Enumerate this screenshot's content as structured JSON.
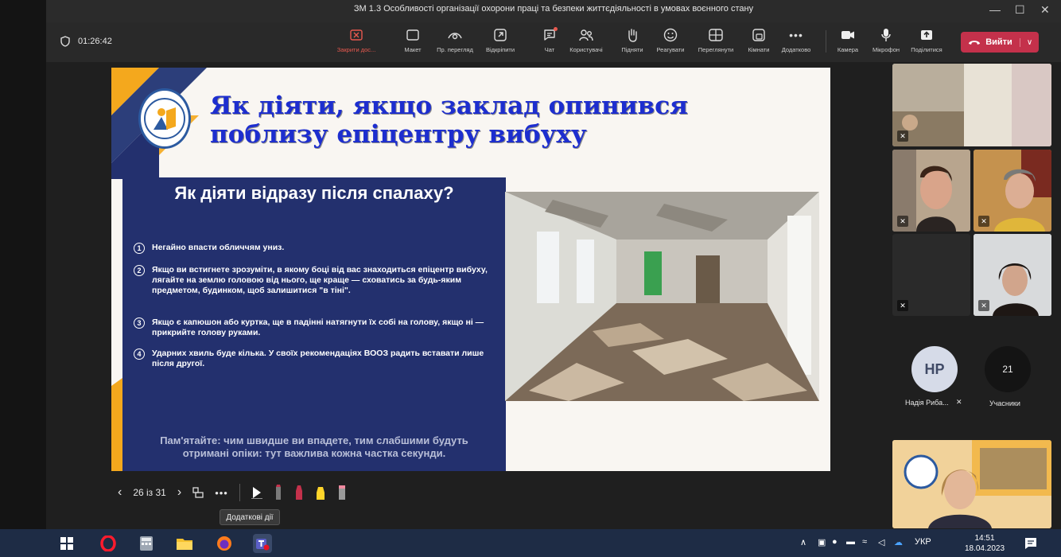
{
  "window": {
    "title": "ЗМ 1.3 Особливості організації охорони праці та безпеки життєдіяльності в умовах воєнного стану",
    "controls": [
      "—",
      "☐",
      "✕"
    ]
  },
  "toolbar": {
    "timer": "01:26:42",
    "items": [
      {
        "label": "Закрити дос...",
        "icon": "close-share-icon"
      },
      {
        "label": "Макет",
        "icon": "layout-icon"
      },
      {
        "label": "Пр. перегляд",
        "icon": "preview-icon"
      },
      {
        "label": "Відкріпити",
        "icon": "pop-out-icon"
      },
      {
        "label": "Чат",
        "icon": "chat-icon"
      },
      {
        "label": "Користувачі",
        "icon": "people-icon"
      },
      {
        "label": "Підняти",
        "icon": "raise-hand-icon"
      },
      {
        "label": "Реагувати",
        "icon": "react-icon"
      },
      {
        "label": "Переглянути",
        "icon": "view-icon"
      },
      {
        "label": "Кімнати",
        "icon": "rooms-icon"
      },
      {
        "label": "Додатково",
        "icon": "more-icon"
      },
      {
        "label": "Камера",
        "icon": "camera-icon"
      },
      {
        "label": "Мікрофон",
        "icon": "microphone-icon"
      },
      {
        "label": "Поділитися",
        "icon": "share-icon"
      }
    ],
    "leave_label": "Вийти"
  },
  "slide": {
    "title": "Як діяти, якщо заклад опинився поблизу епіцентру вибуху",
    "panel_title": "Як діяти відразу після спалаху?",
    "steps": [
      {
        "num": "1",
        "text": "Негайно впасти обличчям униз."
      },
      {
        "num": "2",
        "text": "Якщо ви встигнете зрозуміти, в якому боці від вас знаходиться епіцентр вибуху, лягайте на землю головою від нього, ще краще — сховатись за будь-яким предметом, будинком, щоб залишитися \"в тіні\"."
      },
      {
        "num": "3",
        "text": "Якщо є капюшон або куртка, ще в падінні натягнути їх собі на голову, якщо ні — прикрийте голову руками."
      },
      {
        "num": "4",
        "text": "Ударних хвиль буде кілька. У своїх рекомендаціях ВООЗ радить вставати лише після другої."
      }
    ],
    "note": "Пам'ятайте: чим швидше ви впадете, тим слабшими будуть отримані опіки: тут важлива кожна частка секунди."
  },
  "slidenav": {
    "counter": "26 із 31",
    "tooltip": "Додаткові дії"
  },
  "participants": {
    "avatar_initials": "НР",
    "avatar_name": "Надія Риба...",
    "count": "21",
    "count_label": "Учасники"
  },
  "taskbar": {
    "lang": "УКР",
    "time": "14:51",
    "date": "18.04.2023"
  },
  "colors": {
    "leave": "#c4314b",
    "slide_title": "#1d2ecf",
    "panel": "#23306e",
    "taskbar": "#1e2c45"
  }
}
